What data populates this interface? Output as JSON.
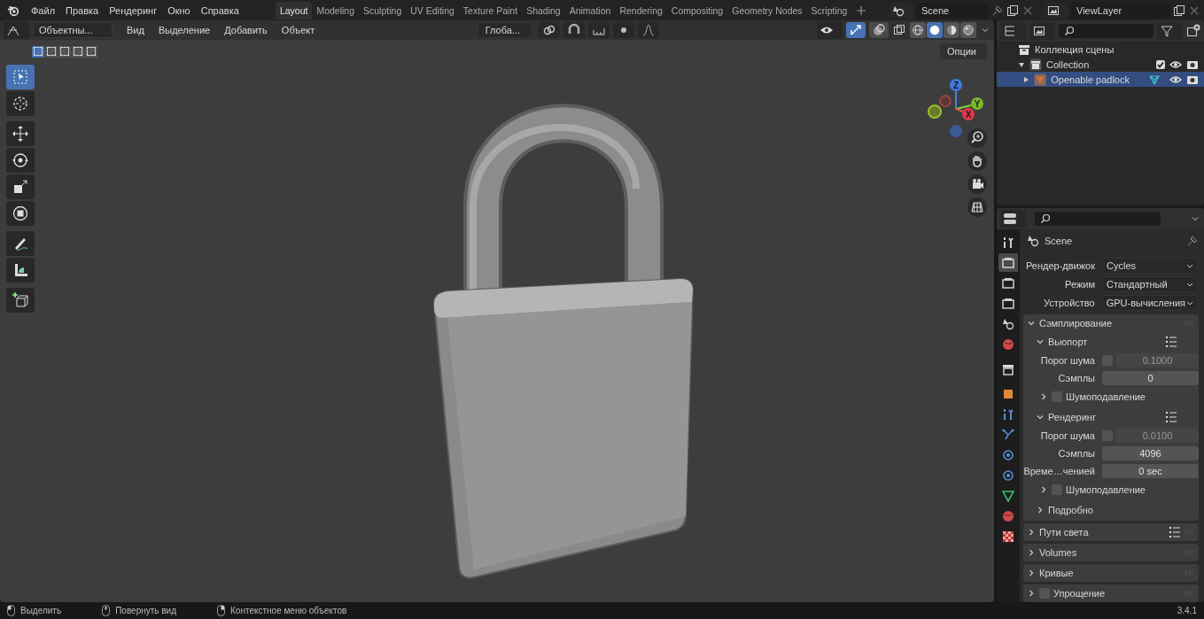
{
  "menu": [
    {
      "label": "Файл"
    },
    {
      "label": "Правка"
    },
    {
      "label": "Рендеринг"
    },
    {
      "label": "Окно"
    },
    {
      "label": "Справка"
    }
  ],
  "workspaces": [
    {
      "label": "Layout",
      "selected": true
    },
    {
      "label": "Modeling",
      "selected": false
    },
    {
      "label": "Sculpting",
      "selected": false
    },
    {
      "label": "UV Editing",
      "selected": false
    },
    {
      "label": "Texture Paint",
      "selected": false
    },
    {
      "label": "Shading",
      "selected": false
    },
    {
      "label": "Animation",
      "selected": false
    },
    {
      "label": "Rendering",
      "selected": false
    },
    {
      "label": "Compositing",
      "selected": false
    },
    {
      "label": "Geometry Nodes",
      "selected": false
    },
    {
      "label": "Scripting",
      "selected": false
    }
  ],
  "scene": {
    "name": "Scene"
  },
  "view_layer": {
    "name": "ViewLayer"
  },
  "viewport": {
    "mode": "Объектны...",
    "menu": [
      "Вид",
      "Выделение",
      "Добавить",
      "Объект"
    ],
    "orientation": "Глоба...",
    "options": "Опции",
    "select_modes": [
      {
        "selected": true
      },
      {
        "selected": false
      },
      {
        "selected": false
      },
      {
        "selected": false
      },
      {
        "selected": false
      }
    ],
    "overlays_on": true,
    "shading_modes": [
      {
        "kind": "wireframe",
        "selected": false
      },
      {
        "kind": "solid",
        "selected": true
      },
      {
        "kind": "material",
        "selected": false
      },
      {
        "kind": "rendered",
        "selected": false
      }
    ],
    "tools": [
      {
        "kind": "select_box",
        "selected": true
      },
      {
        "kind": "cursor",
        "selected": false
      },
      {
        "kind": "move",
        "selected": false
      },
      {
        "kind": "rotate",
        "selected": false
      },
      {
        "kind": "scale",
        "selected": false
      },
      {
        "kind": "transform",
        "selected": false
      },
      {
        "kind": "annotate",
        "selected": false
      },
      {
        "kind": "measure",
        "selected": false
      },
      {
        "kind": "add_cube",
        "selected": false
      }
    ],
    "gizmo": {
      "z": "Z",
      "y": "Y",
      "x": "X"
    }
  },
  "outliner": {
    "items": [
      {
        "kind": "scene_collection",
        "label": "Коллекция сцены",
        "children": [
          {
            "kind": "collection",
            "label": "Collection",
            "expanded": true,
            "checked": true,
            "selected": false,
            "children": [
              {
                "kind": "object",
                "label": "Openable padlock",
                "expanded": false,
                "selected": true
              }
            ]
          }
        ]
      }
    ]
  },
  "properties": {
    "context": "Scene",
    "tabs": [
      {
        "kind": "tool",
        "selected": false
      },
      {
        "kind": "render",
        "selected": true
      },
      {
        "kind": "output",
        "selected": false
      },
      {
        "kind": "view_layer",
        "selected": false
      },
      {
        "kind": "scene",
        "selected": false
      },
      {
        "kind": "world",
        "selected": false
      },
      {
        "kind": "collection",
        "selected": false
      },
      {
        "kind": "object",
        "selected": false
      },
      {
        "kind": "modifiers",
        "selected": false
      },
      {
        "kind": "particles",
        "selected": false
      },
      {
        "kind": "physics",
        "selected": false
      },
      {
        "kind": "constraints",
        "selected": false
      },
      {
        "kind": "data",
        "selected": false
      },
      {
        "kind": "material",
        "selected": false
      },
      {
        "kind": "texture",
        "selected": false
      }
    ],
    "fields": [
      {
        "label": "Рендер-движок",
        "value": "Cycles"
      },
      {
        "label": "Режим",
        "value": "Стандартный"
      },
      {
        "label": "Устройство",
        "value": "GPU-вычисления"
      }
    ],
    "panels": [
      {
        "title": "Сэмплирование",
        "expanded": true,
        "subpanels": [
          {
            "title": "Вьюпорт",
            "expanded": true,
            "presets": true,
            "rows": [
              {
                "kind": "toggle_number",
                "label": "Порог шума",
                "checked": false,
                "value": "0.1000"
              },
              {
                "kind": "number",
                "label": "Сэмплы",
                "value": "0"
              },
              {
                "kind": "check_subpanel",
                "label": "Шумоподавление",
                "checked": false,
                "expanded": false
              }
            ]
          },
          {
            "title": "Рендеринг",
            "expanded": true,
            "presets": true,
            "rows": [
              {
                "kind": "toggle_number",
                "label": "Порог шума",
                "checked": false,
                "value": "0.0100"
              },
              {
                "kind": "number",
                "label": "Сэмплы",
                "value": "4096"
              },
              {
                "kind": "number",
                "label": "Време…ченией",
                "value": "0 sec"
              },
              {
                "kind": "check_subpanel",
                "label": "Шумоподавление",
                "checked": false,
                "expanded": false
              }
            ]
          },
          {
            "title": "Подробно",
            "expanded": false
          }
        ]
      },
      {
        "title": "Пути света",
        "expanded": false,
        "presets": true
      },
      {
        "title": "Volumes",
        "expanded": false
      },
      {
        "title": "Кривые",
        "expanded": false
      },
      {
        "title": "Упрощение",
        "expanded": false,
        "checked": false
      }
    ]
  },
  "status_bar": {
    "hints": [
      {
        "kind": "left",
        "label": "Выделить"
      },
      {
        "kind": "middle",
        "label": "Повернуть вид"
      },
      {
        "kind": "right",
        "label": "Контекстное меню объектов"
      }
    ],
    "version": "3.4.1"
  }
}
